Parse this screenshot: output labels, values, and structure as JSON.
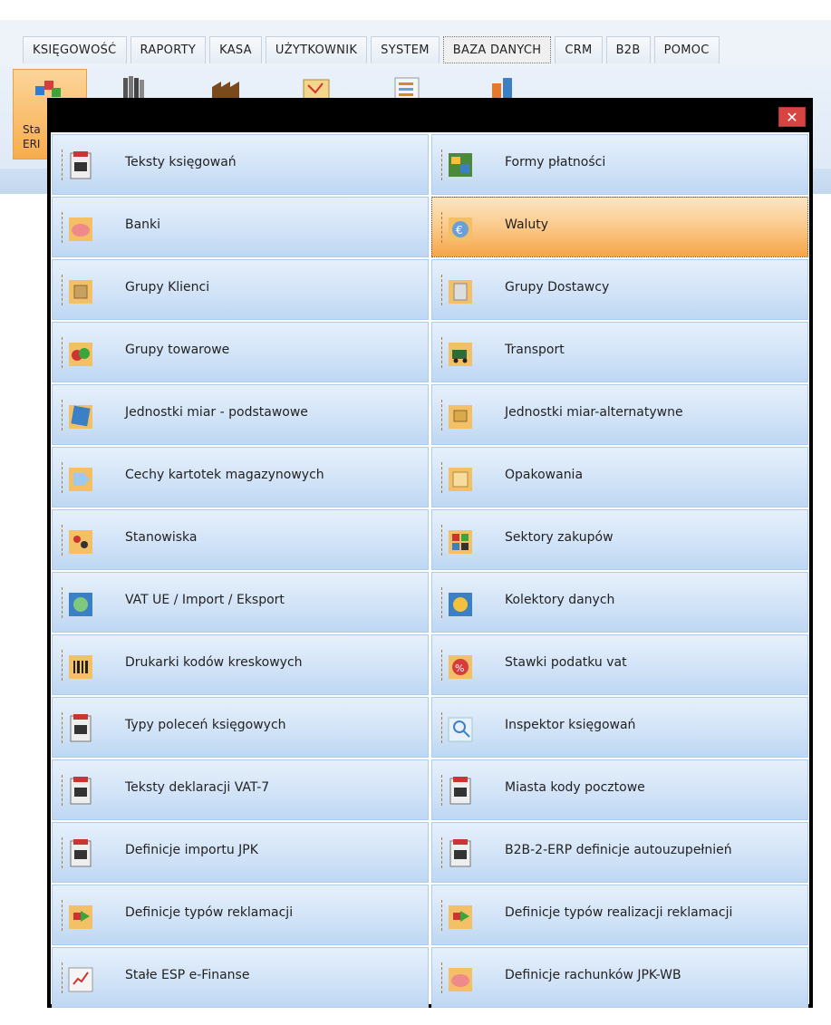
{
  "menu": {
    "tabs": [
      {
        "label": "KSIĘGOWOŚĆ"
      },
      {
        "label": "RAPORTY"
      },
      {
        "label": "KASA"
      },
      {
        "label": "UŻYTKOWNIK"
      },
      {
        "label": "SYSTEM"
      },
      {
        "label": "BAZA DANYCH",
        "active": true
      },
      {
        "label": "CRM"
      },
      {
        "label": "B2B"
      },
      {
        "label": "POMOC"
      }
    ]
  },
  "ribbon": {
    "first_label_line1": "Sta",
    "first_label_line2": "ERI"
  },
  "dialog": {
    "close_label": "✕",
    "items": [
      {
        "label": "Teksty księgowań",
        "icon": "document-icon"
      },
      {
        "label": "Formy płatności",
        "icon": "payment-forms-icon"
      },
      {
        "label": "Banki",
        "icon": "piggy-bank-icon"
      },
      {
        "label": "Waluty",
        "icon": "currency-icon",
        "selected": true
      },
      {
        "label": "Grupy Klienci",
        "icon": "client-groups-icon"
      },
      {
        "label": "Grupy Dostawcy",
        "icon": "supplier-groups-icon"
      },
      {
        "label": "Grupy towarowe",
        "icon": "product-groups-icon"
      },
      {
        "label": "Transport",
        "icon": "truck-icon"
      },
      {
        "label": "Jednostki miar - podstawowe",
        "icon": "units-basic-icon"
      },
      {
        "label": "Jednostki miar-alternatywne",
        "icon": "units-alternative-icon"
      },
      {
        "label": "Cechy kartotek magazynowych",
        "icon": "tag-icon"
      },
      {
        "label": "Opakowania",
        "icon": "package-icon"
      },
      {
        "label": "Stanowiska",
        "icon": "positions-icon"
      },
      {
        "label": "Sektory zakupów",
        "icon": "purchase-sectors-icon"
      },
      {
        "label": "VAT UE / Import / Eksport",
        "icon": "globe-icon"
      },
      {
        "label": "Kolektory danych",
        "icon": "data-collector-icon"
      },
      {
        "label": "Drukarki kodów kreskowych",
        "icon": "barcode-icon"
      },
      {
        "label": "Stawki podatku vat",
        "icon": "percent-icon"
      },
      {
        "label": "Typy poleceń księgowych",
        "icon": "document-icon"
      },
      {
        "label": "Inspektor księgowań",
        "icon": "inspector-icon"
      },
      {
        "label": "Teksty deklaracji VAT-7",
        "icon": "document-icon"
      },
      {
        "label": "Miasta kody pocztowe",
        "icon": "document-icon"
      },
      {
        "label": "Definicje importu JPK",
        "icon": "document-icon"
      },
      {
        "label": "B2B-2-ERP definicje autouzupełnień",
        "icon": "document-icon"
      },
      {
        "label": "Definicje typów reklamacji",
        "icon": "complaint-types-icon"
      },
      {
        "label": "Definicje typów realizacji reklamacji",
        "icon": "complaint-types-icon"
      },
      {
        "label": "Stałe ESP e-Finanse",
        "icon": "finance-icon"
      },
      {
        "label": "Definicje rachunków JPK-WB",
        "icon": "piggy-bank-icon"
      }
    ]
  },
  "colors": {
    "item_gradient_top": "#e6f0fb",
    "item_gradient_bottom": "#bed7f3",
    "selected_gradient_top": "#fde6c3",
    "selected_gradient_bottom": "#f6a546",
    "close_button": "#d64541"
  }
}
